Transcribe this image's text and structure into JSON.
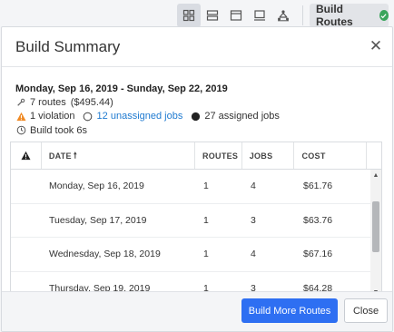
{
  "toolbar": {
    "views": [
      {
        "icon": "grid-view-icon",
        "active": true
      },
      {
        "icon": "list-view-icon",
        "active": false
      },
      {
        "icon": "panel-view-icon",
        "active": false
      },
      {
        "icon": "monitor-view-icon",
        "active": false
      },
      {
        "icon": "route-map-icon",
        "active": false
      }
    ],
    "build_routes_label": "Build Routes",
    "build_status_icon": "check-circle-icon"
  },
  "modal": {
    "title": "Build Summary",
    "close_icon": "close-icon"
  },
  "summary": {
    "date_range": "Monday, Sep 16, 2019 - Sunday, Sep 22, 2019",
    "routes": "7 routes",
    "routes_cost": "($495.44)",
    "violations": "1 violation",
    "unassigned": "12 unassigned jobs",
    "assigned": "27 assigned jobs",
    "build_time": "Build took 6s"
  },
  "table": {
    "columns": [
      "DATE",
      "ROUTES",
      "JOBS",
      "COST"
    ],
    "rows": [
      {
        "date": "Monday, Sep 16, 2019",
        "routes": "1",
        "jobs": "4",
        "cost": "$61.76"
      },
      {
        "date": "Tuesday, Sep 17, 2019",
        "routes": "1",
        "jobs": "3",
        "cost": "$63.76"
      },
      {
        "date": "Wednesday, Sep 18, 2019",
        "routes": "1",
        "jobs": "4",
        "cost": "$67.16"
      },
      {
        "date": "Thursday, Sep 19, 2019",
        "routes": "1",
        "jobs": "3",
        "cost": "$64.28"
      }
    ]
  },
  "footer": {
    "primary_label": "Build More Routes",
    "close_label": "Close"
  },
  "colors": {
    "primary": "#2e6ff2",
    "success": "#3aa55b",
    "warning": "#f08a24",
    "link": "#1f7ad0"
  }
}
